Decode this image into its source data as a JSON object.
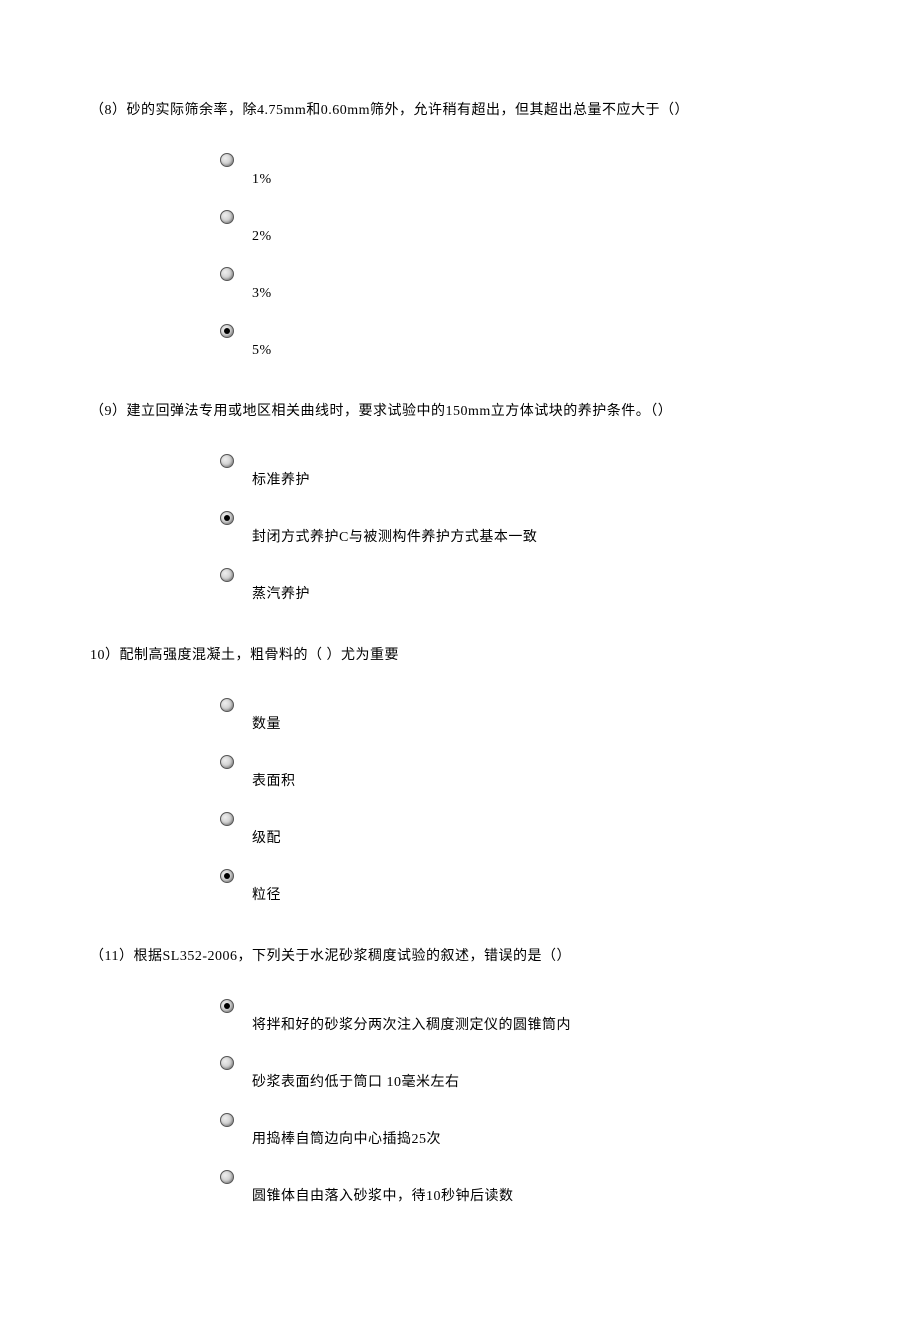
{
  "questions": [
    {
      "text": "（8）砂的实际筛余率，除4.75mm和0.60mm筛外，允许稍有超出，但其超出总量不应大于（）",
      "options": [
        {
          "label": "1%",
          "selected": false
        },
        {
          "label": "2%",
          "selected": false
        },
        {
          "label": "3%",
          "selected": false
        },
        {
          "label": "5%",
          "selected": true
        }
      ]
    },
    {
      "text": "（9）建立回弹法专用或地区相关曲线时，要求试验中的150mm立方体试块的养护条件。（）",
      "options": [
        {
          "label": "标准养护",
          "selected": false
        },
        {
          "label": "封闭方式养护C与被测构件养护方式基本一致",
          "selected": true
        },
        {
          "label": "蒸汽养护",
          "selected": false
        }
      ]
    },
    {
      "text": "10）配制高强度混凝土，粗骨料的（ ）尤为重要",
      "options": [
        {
          "label": "数量",
          "selected": false
        },
        {
          "label": "表面积",
          "selected": false
        },
        {
          "label": "级配",
          "selected": false
        },
        {
          "label": "粒径",
          "selected": true
        }
      ]
    },
    {
      "text": "（11）根据SL352-2006，下列关于水泥砂浆稠度试验的叙述，错误的是（）",
      "options": [
        {
          "label": "将拌和好的砂浆分两次注入稠度测定仪的圆锥筒内",
          "selected": true
        },
        {
          "label": "砂浆表面约低于筒口 10毫米左右",
          "selected": false
        },
        {
          "label": "用捣棒自筒边向中心插捣25次",
          "selected": false
        },
        {
          "label": "圆锥体自由落入砂浆中，待10秒钟后读数",
          "selected": false
        }
      ]
    }
  ]
}
